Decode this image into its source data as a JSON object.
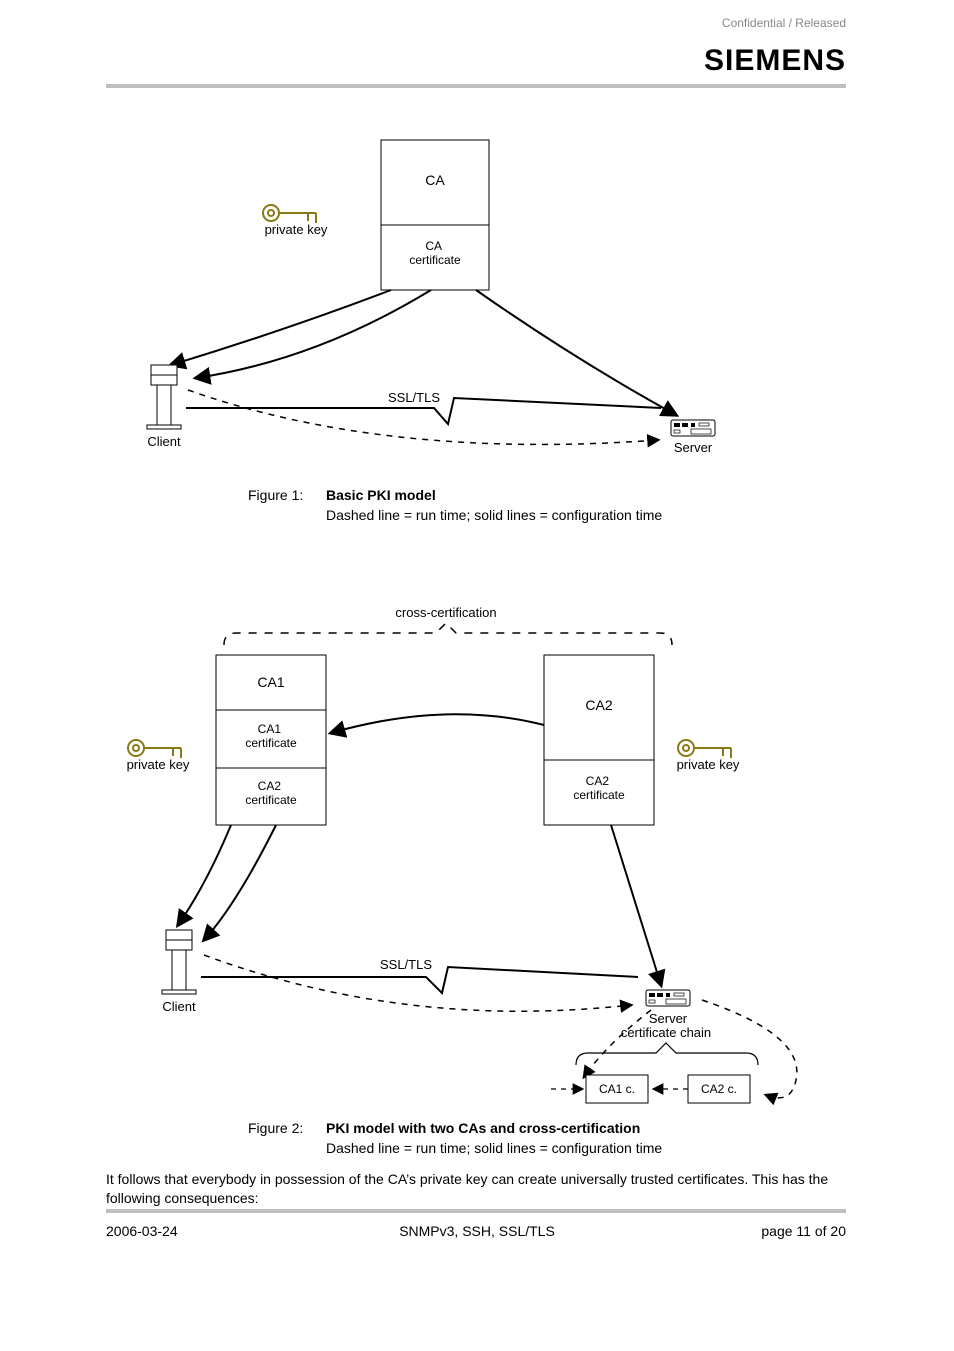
{
  "brand": "SIEMENS",
  "header": {
    "right": "Confidential / Released"
  },
  "fig1": {
    "key_label": "private key",
    "ca_box": {
      "top": "CA",
      "bottom": "CA certificate"
    },
    "client": "Client",
    "server": "Server",
    "ssl": "SSL/TLS",
    "caption_label": "Figure 1:",
    "caption_title": "Basic PKI model",
    "caption_sub": "Dashed line = run time; solid lines = configuration time"
  },
  "fig2": {
    "brace_label": "cross-certification",
    "ca1": {
      "top": "CA1",
      "mid": "CA1 certificate",
      "bot": "CA2 certificate"
    },
    "ca2": {
      "top": "CA2",
      "bot": "CA2 certificate"
    },
    "key_label": "private key",
    "client": "Client",
    "server": "Server",
    "ssl": "SSL/TLS",
    "chain_label": "certificate chain",
    "chain": {
      "left": "CA1 c.",
      "right": "CA2 c."
    },
    "caption_label": "Figure 2:",
    "caption_title": "PKI model with two CAs and cross-certification",
    "caption_sub": "Dashed line = run time; solid lines = configuration time"
  },
  "body_para": "It follows that everybody in possession of the CA’s private key can create universally trusted certificates. This has the following consequences:",
  "footer": {
    "left": "2006-03-24",
    "center": "SNMPv3, SSH, SSL/TLS",
    "right": "page 11 of 20"
  }
}
